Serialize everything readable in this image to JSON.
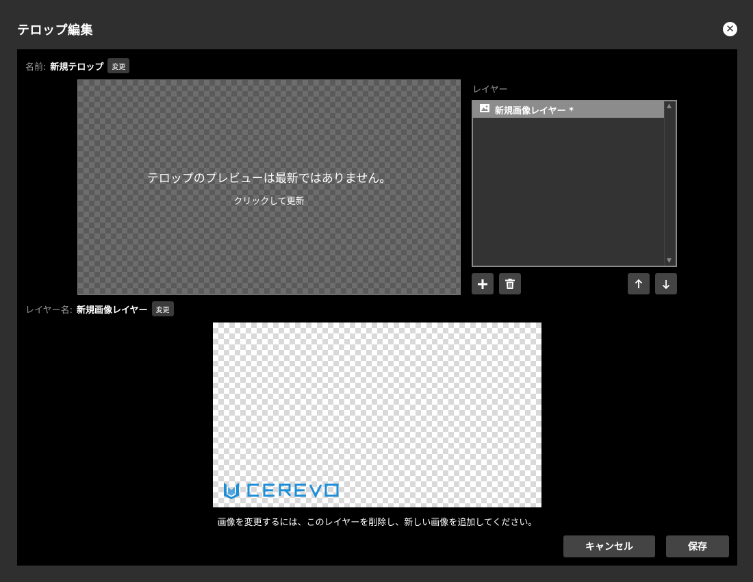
{
  "dialog": {
    "title": "テロップ編集",
    "close_icon": "close-icon"
  },
  "telop": {
    "name_label": "名前:",
    "name_value": "新規テロップ",
    "change_label": "変更"
  },
  "preview": {
    "message": "テロップのプレビューは最新ではありません。",
    "action": "クリックして更新"
  },
  "layers": {
    "heading": "レイヤー",
    "items": [
      {
        "label": "新規画像レイヤー *",
        "icon": "image-icon",
        "selected": true
      }
    ],
    "buttons": {
      "add": "plus-icon",
      "delete": "trash-icon",
      "up": "arrow-up-icon",
      "down": "arrow-down-icon"
    }
  },
  "layer_detail": {
    "name_label": "レイヤー名:",
    "name_value": "新規画像レイヤー",
    "change_label": "変更"
  },
  "image": {
    "logo_text": "CEREVO"
  },
  "note": "画像を変更するには、このレイヤーを削除し、新しい画像を追加してください。",
  "footer": {
    "cancel_label": "キャンセル",
    "save_label": "保存"
  },
  "colors": {
    "logo": "#1d8fd8",
    "panel": "#000000",
    "dialog": "#2f2f2f"
  }
}
